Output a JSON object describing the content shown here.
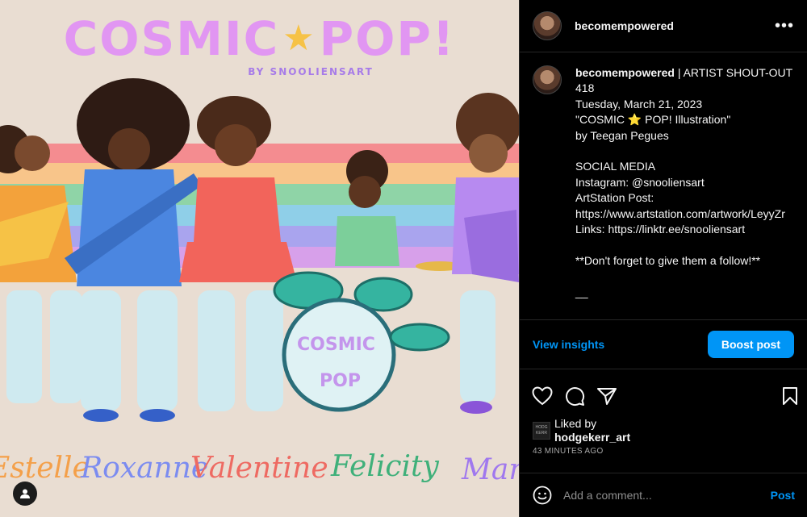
{
  "artwork": {
    "title_left": "COSMIC",
    "title_star": "★",
    "title_right": "POP!",
    "byline": "BY SNOOLIENSART",
    "drum_top": "COSMIC",
    "drum_bottom": "POP",
    "names": [
      "Estelle",
      "Roxanne",
      "Valentine",
      "Felicity",
      "Maripo"
    ],
    "colors": {
      "background": "#e9ddd2",
      "title": "#e196f2",
      "star": "#f6c246"
    }
  },
  "post": {
    "username": "becomempowered",
    "menu_icon": "more-horizontal-icon",
    "caption": {
      "username": "becomempowered",
      "lines": [
        " | ARTIST SHOUT-OUT 418",
        "Tuesday, March 21, 2023",
        "\"COSMIC ⭐ POP! Illustration\"",
        "by Teegan Pegues",
        "",
        "SOCIAL MEDIA",
        "Instagram: @snooliensart",
        "ArtStation Post:",
        "https://www.artstation.com/artwork/LeyyZr",
        "Links: https://linktr.ee/snooliensart",
        "",
        "**Don't forget to give them a follow!**",
        "",
        "__"
      ]
    },
    "insights_label": "View insights",
    "boost_label": "Boost post",
    "liked_by_label": "Liked by",
    "liked_by_user": "hodgekerr_art",
    "liked_avatar_text": "HODG KERR",
    "time_ago": "43 MINUTES AGO",
    "comment_placeholder": "Add a comment...",
    "post_label": "Post"
  },
  "colors": {
    "accent": "#0095f6",
    "panel_bg": "#000000",
    "border": "#262626"
  }
}
